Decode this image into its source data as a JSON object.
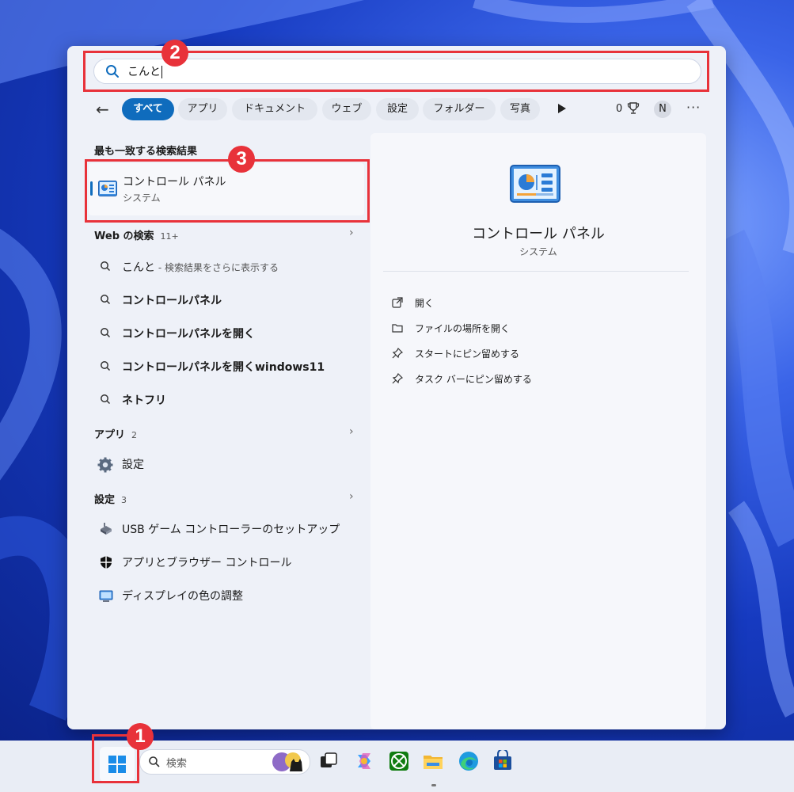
{
  "search": {
    "query": "こんと"
  },
  "filters": {
    "back": "←",
    "chips": [
      {
        "label": "すべて",
        "active": true
      },
      {
        "label": "アプリ",
        "active": false
      },
      {
        "label": "ドキュメント",
        "active": false
      },
      {
        "label": "ウェブ",
        "active": false
      },
      {
        "label": "設定",
        "active": false
      },
      {
        "label": "フォルダー",
        "active": false
      },
      {
        "label": "写真",
        "active": false
      }
    ],
    "points": "0",
    "avatar": "N",
    "more": "···"
  },
  "best_match": {
    "heading": "最も一致する検索結果",
    "title": "コントロール パネル",
    "subtitle": "システム",
    "icon": "control-panel-icon"
  },
  "web": {
    "heading": "Web の検索",
    "count": "11+",
    "items": [
      {
        "bold": "こんと",
        "hint": " - 検索結果をさらに表示する"
      },
      {
        "bold": "コントロールパネル",
        "hint": ""
      },
      {
        "bold": "コントロールパネルを開く",
        "hint": ""
      },
      {
        "bold": "コントロールパネルを開くwindows11",
        "hint": ""
      },
      {
        "bold": "ネトフリ",
        "hint": ""
      }
    ]
  },
  "apps": {
    "heading": "アプリ",
    "count": "2",
    "items": [
      {
        "label": "設定",
        "icon": "gear-icon"
      }
    ]
  },
  "settings": {
    "heading": "設定",
    "count": "3",
    "items": [
      {
        "label": "USB ゲーム コントローラーのセットアップ",
        "icon": "game-controller-icon"
      },
      {
        "label": "アプリとブラウザー コントロール",
        "icon": "shield-icon"
      },
      {
        "label": "ディスプレイの色の調整",
        "icon": "monitor-icon"
      }
    ]
  },
  "preview": {
    "title": "コントロール パネル",
    "subtitle": "システム",
    "actions": [
      {
        "label": "開く",
        "icon": "open-external-icon"
      },
      {
        "label": "ファイルの場所を開く",
        "icon": "folder-icon"
      },
      {
        "label": "スタートにピン留めする",
        "icon": "pin-icon"
      },
      {
        "label": "タスク バーにピン留めする",
        "icon": "pin-icon"
      }
    ]
  },
  "annotations": [
    "1",
    "2",
    "3"
  ],
  "taskbar": {
    "search_placeholder": "検索"
  },
  "colors": {
    "accent": "#0f6cbd",
    "annotation": "#e8323a"
  }
}
